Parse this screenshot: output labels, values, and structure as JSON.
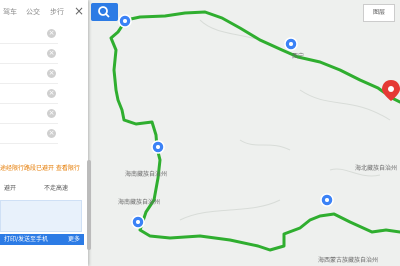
{
  "panel": {
    "mode_drive": "驾车",
    "mode_bus": "公交",
    "mode_walk": "步行",
    "close_glyph": "×",
    "remove_glyph": "×",
    "warning": "途经限行路段已避开 查看限行",
    "option_left": "避开",
    "option_right": "不走高速",
    "route_button": "打印/发送至手机",
    "route_button_right": "更多"
  },
  "toolbar": {
    "layer_label": "图层"
  },
  "map": {
    "labels": {
      "lbl1": "西宁",
      "lbl2": "海北藏族自治州",
      "lbl3": "海南藏族自治州",
      "lbl4": "海南藏族自治州",
      "lbl5": "海西蒙古族藏族自治州"
    },
    "route_color": "#2fae2f",
    "marker_color": "#3b82f6",
    "destination_color": "#e53935"
  }
}
